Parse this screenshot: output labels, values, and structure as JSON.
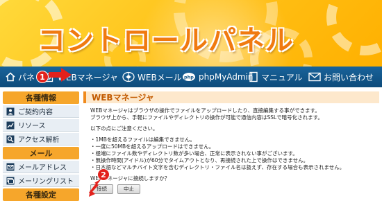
{
  "header": {
    "title": "コントロールパネル"
  },
  "nav": {
    "items": [
      {
        "label": "パネ",
        "icon": "home-icon"
      },
      {
        "label": "WEBマネージャ",
        "icon": "edit-icon"
      },
      {
        "label": "WEBメール",
        "icon": "globe-icon"
      },
      {
        "label": "phpMyAdmin",
        "icon": "php-icon"
      },
      {
        "label": "マニュアル",
        "icon": "book-icon"
      },
      {
        "label": "お問い合わせ",
        "icon": "mail-icon"
      }
    ]
  },
  "sidebar": {
    "sections": [
      {
        "heading": "各種情報",
        "items": [
          {
            "label": "ご契約内容",
            "icon": "user-icon"
          },
          {
            "label": "リソース",
            "icon": "chart-icon"
          },
          {
            "label": "アクセス解析",
            "icon": "search-icon"
          }
        ]
      },
      {
        "heading": "メール",
        "items": [
          {
            "label": "メールアドレス",
            "icon": "mail-icon"
          },
          {
            "label": "メーリングリスト",
            "icon": "mail-list-icon"
          }
        ]
      },
      {
        "heading": "各種設定",
        "items": []
      }
    ]
  },
  "main": {
    "title": "WEBマネージャ",
    "lines": [
      "WEBマネージャはブラウザの操作でファイルをアップロードしたり、直接編集する事ができます。",
      "ブラウザ上から、手軽にファイルやディレクトリの操作が可能で通信内容はSSLで暗号化されます。",
      "以下の点にご注意ください。",
      "・1MBを超えるファイルは編集できません。",
      "・一度に50MBを超えるアップロードはできません。",
      "・極端にファイル数やディレクトリ数が多い場合、正常に表示されない事がございます。",
      "・無操作時間(アイドル)が60分でタイムアウトとなり、再接続された上で操作はできません。",
      "・日本語などマルチバイト文字を含むディレクトリ・ファイル名は扱えず、存在する場合も表示されません。",
      "WEBマネージャに接続しますか？"
    ],
    "connect_button": "接続",
    "cancel_button": "中止"
  },
  "markers": {
    "one": "1",
    "two": "2"
  },
  "colors": {
    "navbar": "#0f5588",
    "accent": "#f08a1c",
    "marker": "#e2211c"
  }
}
